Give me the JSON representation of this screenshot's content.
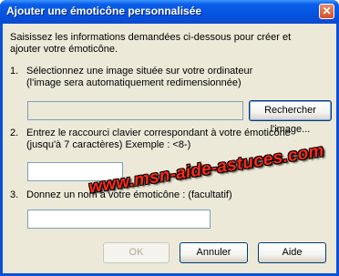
{
  "window": {
    "title": "Ajouter une émoticône personnalisée",
    "close_label": "✕"
  },
  "intro": {
    "line1": "Saisissez les informations demandées ci-dessous pour créer et",
    "line2": "ajouter votre émoticône."
  },
  "step1": {
    "number": "1.",
    "line1": "Sélectionnez une image située sur votre ordinateur",
    "line2": "(l'image sera automatiquement redimensionnée)",
    "path_value": "",
    "browse_label": "Rechercher l'image..."
  },
  "step2": {
    "number": "2.",
    "line1": "Entrez le raccourci clavier correspondant à votre émoticône",
    "line2": "(jusqu'à 7 caractères)  Exemple : <8-)",
    "shortcut_value": ""
  },
  "step3": {
    "number": "3.",
    "line1": "Donnez un nom à votre émoticône : (facultatif)",
    "name_value": ""
  },
  "buttons": {
    "ok_label": "OK",
    "cancel_label": "Annuler",
    "help_label": "Aide"
  },
  "watermark": "www.msn-aide-astuces.com"
}
